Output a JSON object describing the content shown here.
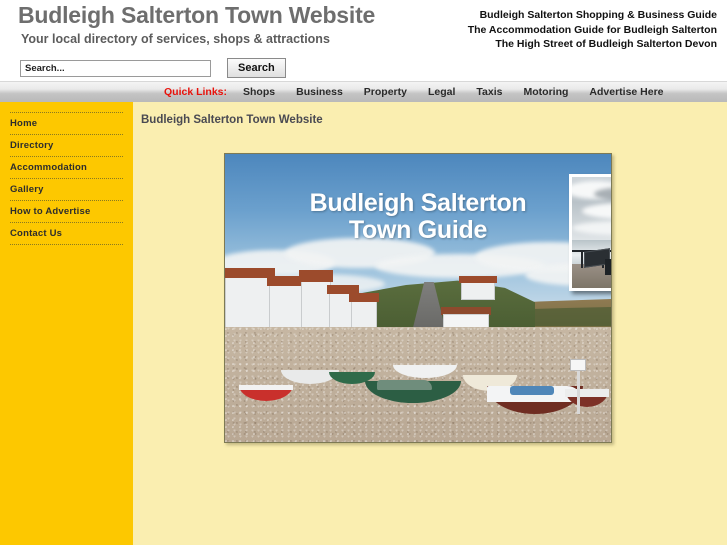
{
  "header": {
    "title": "Budleigh Salterton Town Website",
    "tagline": "Your local directory of services, shops & attractions",
    "links": [
      "Budleigh Salterton Shopping & Business Guide",
      "The Accommodation Guide for Budleigh Salterton",
      "The High Street of Budleigh Salterton Devon"
    ]
  },
  "search": {
    "placeholder": "Search...",
    "value": "",
    "button_label": "Search"
  },
  "quicklinks": {
    "label": "Quick Links:",
    "items": [
      "Shops",
      "Business",
      "Property",
      "Legal",
      "Taxis",
      "Motoring",
      "Advertise Here"
    ]
  },
  "sidebar": {
    "items": [
      "Home",
      "Directory",
      "Accommodation",
      "Gallery",
      "How to Advertise",
      "Contact Us"
    ]
  },
  "content": {
    "title": "Budleigh Salterton Town Website",
    "hero": {
      "overlay_line1": "Budleigh Salterton",
      "overlay_line2": "Town Guide",
      "alt": "Boats on the pebble beach at Budleigh Salterton with seafront houses and red cliffs",
      "inset_alt": "People on benches looking out to sea from the Budleigh Salterton promenade"
    }
  },
  "colors": {
    "sidebar_bg": "#fdc800",
    "content_bg": "#faeeb0",
    "quicklinks_accent": "#e8120b",
    "title_text": "#6e6e6e",
    "nav_bar_top": "#f4f4f4",
    "nav_bar_bottom": "#b9b9b9"
  }
}
